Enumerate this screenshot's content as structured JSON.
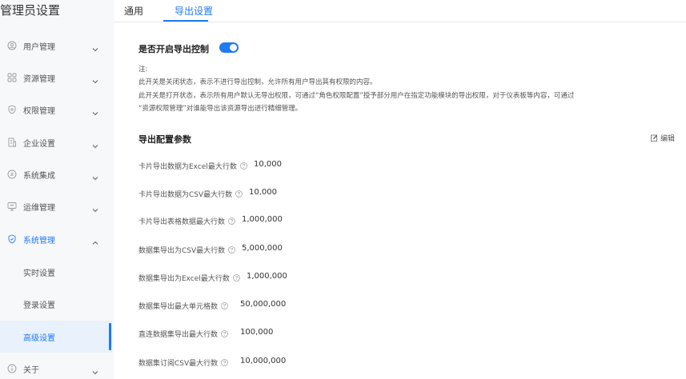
{
  "sidebar": {
    "title": "管理员设置",
    "items": [
      {
        "label": "用户管理",
        "icon": "user-icon"
      },
      {
        "label": "资源管理",
        "icon": "grid-icon"
      },
      {
        "label": "权限管理",
        "icon": "shield-icon"
      },
      {
        "label": "企业设置",
        "icon": "building-icon"
      },
      {
        "label": "系统集成",
        "icon": "integration-icon"
      },
      {
        "label": "运维管理",
        "icon": "monitor-icon"
      },
      {
        "label": "系统管理",
        "icon": "system-icon"
      }
    ],
    "sub_items": [
      {
        "label": "实时设置"
      },
      {
        "label": "登录设置"
      },
      {
        "label": "高级设置"
      }
    ],
    "about": {
      "label": "关于",
      "icon": "info-icon"
    }
  },
  "tabs": [
    {
      "label": "通用"
    },
    {
      "label": "导出设置"
    }
  ],
  "export_control": {
    "title": "是否开启导出控制",
    "enabled": true,
    "note_heading": "注:",
    "note_line1": "此开关是关闭状态，表示不进行导出控制，允许所有用户导出其有权限的内容。",
    "note_line2": "此开关是打开状态，表示所有用户默认无导出权限，可通过“角色权限配置”授予部分用户在指定功能模块的导出权限，对于仪表板等内容，可通过",
    "note_line3": "“资源权限管理”对谁能导出该资源导出进行精细管理。"
  },
  "params": {
    "title": "导出配置参数",
    "edit_label": "编辑",
    "rows": [
      {
        "label": "卡片导出数据为Excel最大行数",
        "value": "10,000"
      },
      {
        "label": "卡片导出数据为CSV最大行数",
        "value": "10,000"
      },
      {
        "label": "卡片导出表格数据最大行数",
        "value": "1,000,000"
      },
      {
        "label": "数据集导出为CSV最大行数",
        "value": "5,000,000"
      },
      {
        "label": "数据集导出为Excel最大行数",
        "value": "1,000,000"
      },
      {
        "label": "数据集导出最大单元格数",
        "value": "50,000,000"
      },
      {
        "label": "直连数据集导出最大行数",
        "value": "100,000"
      },
      {
        "label": "数据集订阅CSV最大行数",
        "value": "10,000,000"
      }
    ]
  },
  "colors": {
    "accent": "#1f7bf2",
    "sidebar_bg": "#f7f8fa",
    "active_item_bg": "#e8f1fc"
  }
}
